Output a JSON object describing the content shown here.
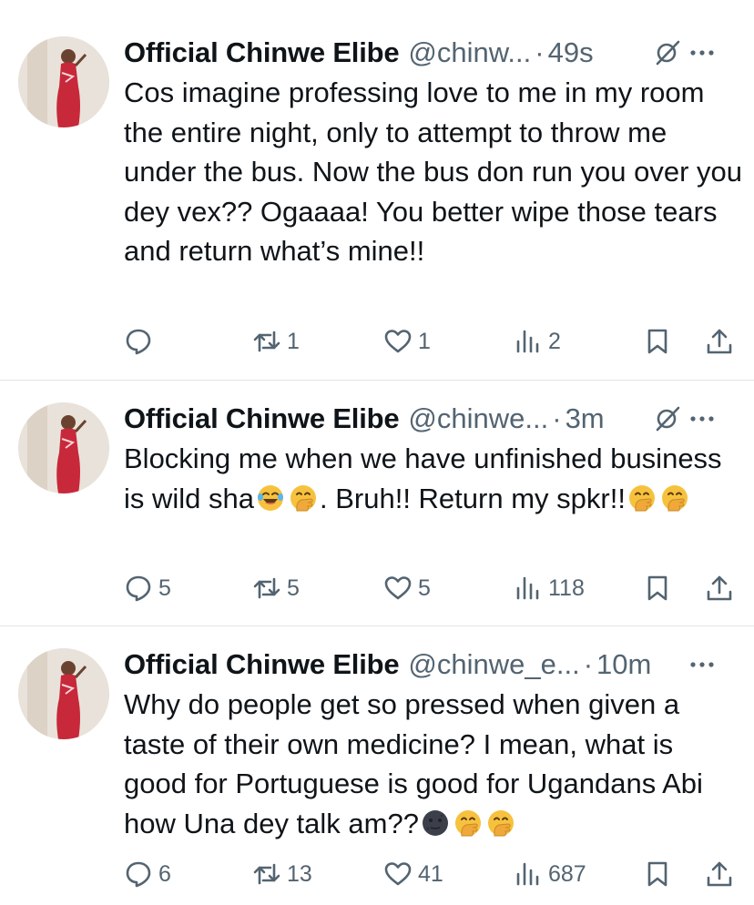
{
  "tweets": [
    {
      "name": "Official Chinwe Elibe",
      "handle": "@chinw...",
      "dot": "·",
      "time": "49s",
      "text_parts": [
        "Cos imagine professing love to me in my room the entire night, only to attempt to throw me under the bus. Now the bus don run you over you dey vex?? Ogaaaa! You better wipe those tears and return what’s mine!!"
      ],
      "replies": "",
      "retweets": "1",
      "likes": "1",
      "views": "2",
      "has_grok": true
    },
    {
      "name": "Official Chinwe Elibe",
      "handle": "@chinwe...",
      "dot": "·",
      "time": "3m",
      "text_parts": [
        "Blocking me when we have unfinished business is wild sha",
        ". Bruh!! Return my spkr!!"
      ],
      "replies": "5",
      "retweets": "5",
      "likes": "5",
      "views": "118",
      "has_grok": true
    },
    {
      "name": "Official Chinwe Elibe",
      "handle": "@chinwe_e...",
      "dot": "·",
      "time": "10m",
      "text_parts": [
        "Why do people get so pressed when given a taste of their own medicine? I mean, what is good for Portuguese is good for Ugandans Abi how Una dey talk am??"
      ],
      "replies": "6",
      "retweets": "13",
      "likes": "41",
      "views": "687",
      "has_grok": false
    }
  ],
  "icons": {
    "reply": "reply-icon",
    "retweet": "retweet-icon",
    "like": "heart-icon",
    "views": "views-icon",
    "bookmark": "bookmark-icon",
    "share": "share-icon",
    "grok": "grok-icon",
    "more": "more-icon",
    "emoji_joy": "face-with-tears-of-joy-emoji",
    "emoji_hand_over_mouth": "face-with-hand-over-mouth-emoji",
    "emoji_new_moon": "new-moon-face-emoji"
  },
  "colors": {
    "text": "#0f1419",
    "secondary": "#536471",
    "divider": "#e1e4e8",
    "emoji_yellow": "#f6c23e"
  }
}
